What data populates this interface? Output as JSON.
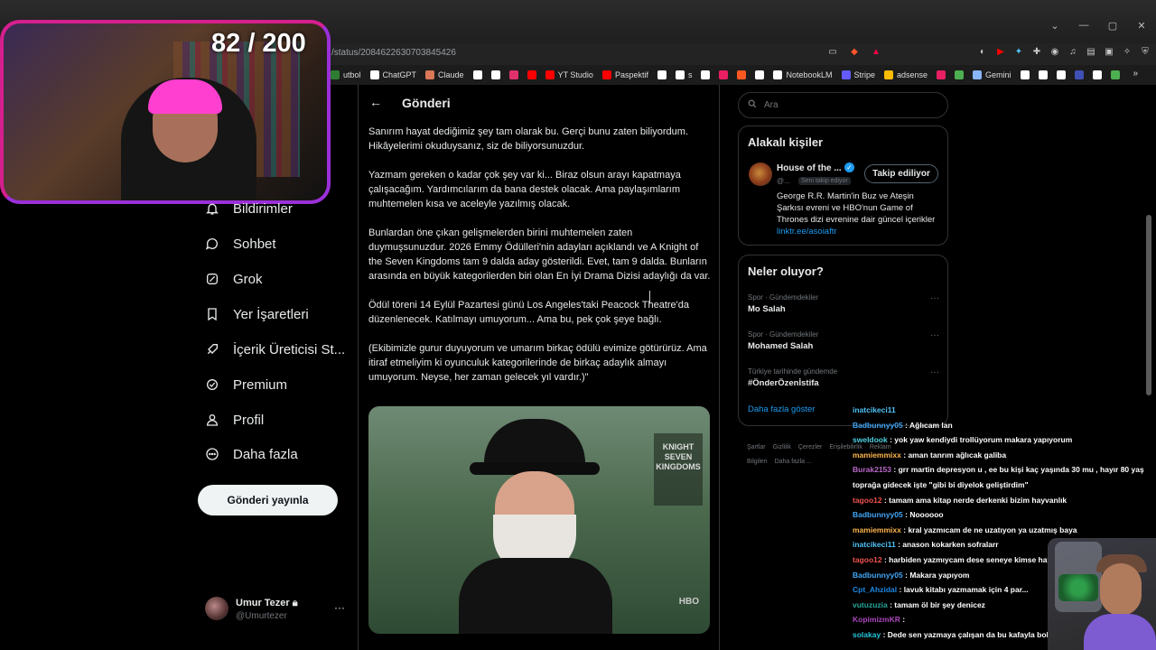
{
  "browser": {
    "url": "/status/2084622630703845426",
    "bookmarks": [
      {
        "label": "utbol",
        "color": "#2e7d32"
      },
      {
        "label": "ChatGPT",
        "color": "#ffffff"
      },
      {
        "label": "Claude",
        "color": "#d97757"
      },
      {
        "label": "",
        "color": "#ffffff"
      },
      {
        "label": "",
        "color": "#ffffff"
      },
      {
        "label": "",
        "color": "#e1306c"
      },
      {
        "label": "",
        "color": "#ff0000"
      },
      {
        "label": "YT Studio",
        "color": "#ff0000"
      },
      {
        "label": "Paspektif",
        "color": "#ff0000"
      },
      {
        "label": "",
        "color": "#ffffff"
      },
      {
        "label": "s",
        "color": "#ffffff"
      },
      {
        "label": "",
        "color": "#ffffff"
      },
      {
        "label": "",
        "color": "#e91e63"
      },
      {
        "label": "",
        "color": "#ff5722"
      },
      {
        "label": "",
        "color": "#ffffff"
      },
      {
        "label": "NotebookLM",
        "color": "#ffffff"
      },
      {
        "label": "Stripe",
        "color": "#635bff"
      },
      {
        "label": "adsense",
        "color": "#fbbc04"
      },
      {
        "label": "",
        "color": "#e91e63"
      },
      {
        "label": "",
        "color": "#4caf50"
      },
      {
        "label": "Gemini",
        "color": "#8ab4f8"
      },
      {
        "label": "",
        "color": "#ffffff"
      },
      {
        "label": "",
        "color": "#ffffff"
      },
      {
        "label": "",
        "color": "#ffffff"
      },
      {
        "label": "",
        "color": "#3f51b5"
      },
      {
        "label": "",
        "color": "#ffffff"
      },
      {
        "label": "",
        "color": "#4caf50"
      }
    ],
    "more_icon": "chevron-double-right-icon"
  },
  "webcam": {
    "counter": "82 / 200"
  },
  "nav": {
    "items": [
      {
        "label": "Bildirimler",
        "icon": "bell-icon"
      },
      {
        "label": "Sohbet",
        "icon": "chat-bubble-icon"
      },
      {
        "label": "Grok",
        "icon": "grok-icon"
      },
      {
        "label": "Yer İşaretleri",
        "icon": "bookmark-icon"
      },
      {
        "label": "İçerik Üreticisi St...",
        "icon": "rocket-icon"
      },
      {
        "label": "Premium",
        "icon": "verified-badge-icon"
      },
      {
        "label": "Profil",
        "icon": "person-icon"
      },
      {
        "label": "Daha fazla",
        "icon": "more-circle-icon"
      }
    ],
    "post_button": "Gönderi yayınla",
    "account": {
      "name": "Umur Tezer",
      "handle": "@Umurtezer"
    }
  },
  "main": {
    "title": "Gönderi",
    "paragraphs": [
      "Sanırım hayat dediğimiz şey tam olarak bu. Gerçi bunu zaten biliyordum. Hikâyelerimi okuduysanız, siz de biliyorsunuzdur.",
      "Yazmam gereken o kadar çok şey var ki... Biraz olsun arayı kapatmaya çalışacağım. Yardımcılarım da bana destek olacak. Ama paylaşımlarım muhtemelen kısa ve aceleyle yazılmış olacak.",
      "Bunlardan öne çıkan gelişmelerden birini muhtemelen zaten duymuşsunuzdur. 2026 Emmy Ödülleri'nin adayları açıklandı ve A Knight of the Seven Kingdoms tam 9 dalda aday gösterildi. Evet, tam 9 dalda. Bunların arasında en büyük kategorilerden biri olan En İyi Drama Dizisi adaylığı da var.",
      "Ödül töreni 14 Eylül Pazartesi günü Los Angeles'taki Peacock Theatre'da düzenlenecek. Katılmayı umuyorum... Ama bu, pek çok şeye bağlı.",
      "(Ekibimizle gurur duyuyorum ve umarım birkaç ödülü evimize götürürüz. Ama itiraf etmeliyim ki oyunculuk kategorilerinde de birkaç adaylık almayı umuyorum. Neyse, her zaman gelecek yıl vardır.)\""
    ],
    "image_sign": "KNIGHT SEVEN KINGDOMS",
    "image_hbo": "HBO"
  },
  "right": {
    "search_placeholder": "Ara",
    "related": {
      "title": "Alakalı kişiler",
      "name": "House of the ...",
      "handle": "@...",
      "badge": "Seni takip ediyor",
      "follow_label": "Takip ediliyor",
      "bio": "George R.R. Martin'in Buz ve Ateşin Şarkısı evreni ve HBO'nun Game of Thrones dizi evrenine dair güncel içerikler ",
      "link": "linktr.ee/asoiaftr"
    },
    "trends": {
      "title": "Neler oluyor?",
      "items": [
        {
          "meta": "Spor · Gündemdekiler",
          "name": "Mo Salah"
        },
        {
          "meta": "Spor · Gündemdekiler",
          "name": "Mohamed Salah"
        },
        {
          "meta": "Türkiye tarihinde gündemde",
          "name": "#ÖnderÖzenİstifa"
        }
      ],
      "show_more": "Daha fazla göster"
    },
    "footer_links": [
      "Şartlar",
      "Gizlilik",
      "Çerezler",
      "Erişilebilirlik",
      "Reklam Bilgileri",
      "Daha fazla ..."
    ]
  },
  "chat": [
    {
      "user": "inatcikeci11",
      "msg": "",
      "color": "#4fc3f7"
    },
    {
      "user": "Badbunnyy05",
      "msg": ": Ağlıcam lan",
      "color": "#42a5f5"
    },
    {
      "user": "sweldook",
      "msg": ": yok yaw kendiydi trollüyorum makara yapıyorum",
      "color": "#4dd0e1"
    },
    {
      "user": "mamiemmixx",
      "msg": ": aman tanrım ağlıcak galiba",
      "color": "#ffb74d"
    },
    {
      "user": "Burak2153",
      "msg": ": grr martin depresyon u , ee bu kişi kaç yaşında 30 mu , hayır 80 yaş",
      "color": "#ba68c8"
    },
    {
      "user": "",
      "msg": "toprağa gidecek işte \"gibi bi diyelok geliştirdim\"",
      "color": "#ffffff"
    },
    {
      "user": "tagoo12",
      "msg": ": tamam ama kitap nerde derkenki bizim hayvanlık",
      "color": "#ef5350"
    },
    {
      "user": "Badbunnyy05",
      "msg": ": Noooooo",
      "color": "#42a5f5"
    },
    {
      "user": "mamiemmixx",
      "msg": ": kral yazmıcam de ne uzatıyon ya uzatmış baya",
      "color": "#ffb74d"
    },
    {
      "user": "inatcikeci11",
      "msg": ": anason kokarken sofralarr",
      "color": "#4fc3f7"
    },
    {
      "user": "tagoo12",
      "msg": ": harbiden yazmıycam dese seneye kimse hatırlamaz sq",
      "color": "#ef5350"
    },
    {
      "user": "Badbunnyy05",
      "msg": ": Makara yapıyom",
      "color": "#42a5f5"
    },
    {
      "user": "Cpt_Ahzidal",
      "msg": ": lavuk kitabı yazmamak için 4 par...",
      "color": "#1e88e5"
    },
    {
      "user": "vutuzuzia",
      "msg": ": tamam öl bir şey denicez",
      "color": "#26a69a"
    },
    {
      "user": "KopimizmKR",
      "msg": ":",
      "color": "#ab47bc"
    },
    {
      "user": "solakay",
      "msg": ": Dede sen yazmaya çalışan da bu kafayla bok edersin boş...",
      "color": "#26c6da"
    }
  ]
}
